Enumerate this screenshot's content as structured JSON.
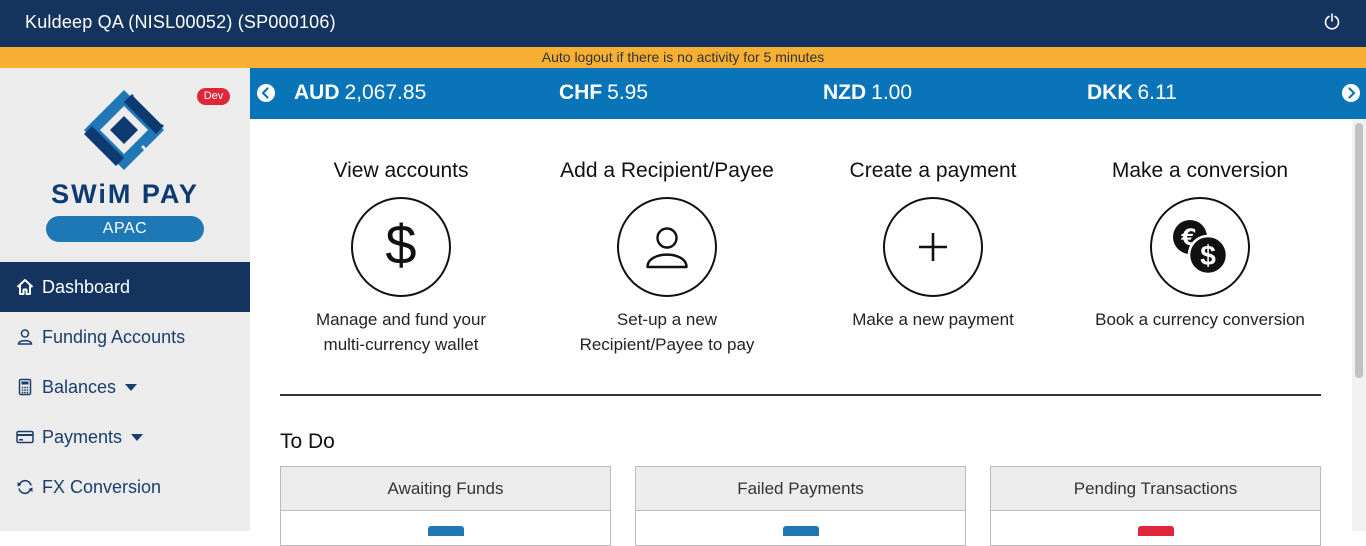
{
  "header": {
    "user_label": "Kuldeep QA (NISL00052) (SP000106)",
    "logout_icon": "power-icon"
  },
  "notice": {
    "text": "Auto logout if there is no activity for 5 minutes"
  },
  "sidebar": {
    "logo": {
      "name": "SWiM PAY",
      "region": "APAC"
    },
    "env_badge": "Dev",
    "items": [
      {
        "label": "Dashboard",
        "icon": "home-icon"
      },
      {
        "label": "Funding Accounts",
        "icon": "user-icon"
      },
      {
        "label": "Balances",
        "icon": "calculator-icon"
      },
      {
        "label": "Payments",
        "icon": "card-icon"
      },
      {
        "label": "FX Conversion",
        "icon": "refresh-icon"
      }
    ]
  },
  "ticker": {
    "rates": [
      {
        "currency": "AUD",
        "value": "2,067.85"
      },
      {
        "currency": "CHF",
        "value": "5.95"
      },
      {
        "currency": "NZD",
        "value": "1.00"
      },
      {
        "currency": "DKK",
        "value": "6.11"
      }
    ]
  },
  "actions": [
    {
      "title": "View accounts",
      "desc1": "Manage and fund your",
      "desc2": "multi-currency wallet",
      "icon": "dollar-icon"
    },
    {
      "title": "Add a Recipient/Payee",
      "desc1": "Set-up a new",
      "desc2": "Recipient/Payee to pay",
      "icon": "person-icon"
    },
    {
      "title": "Create a payment",
      "desc1": "Make a new payment",
      "desc2": "",
      "icon": "plus-icon"
    },
    {
      "title": "Make a conversion",
      "desc1": "Book a currency conversion",
      "desc2": "",
      "icon": "currency-exchange-icon"
    }
  ],
  "todo": {
    "title": "To Do",
    "cards": [
      {
        "label": "Awaiting Funds",
        "color": "#1e78b6"
      },
      {
        "label": "Failed Payments",
        "color": "#1e78b6"
      },
      {
        "label": "Pending Transactions",
        "color": "#e0263a"
      }
    ]
  },
  "colors": {
    "header_bg": "#14345f",
    "notice_bg": "#f7b033",
    "ticker_bg": "#0a74b8",
    "sidebar_bg": "#ececec",
    "badge": "#e0263a"
  }
}
